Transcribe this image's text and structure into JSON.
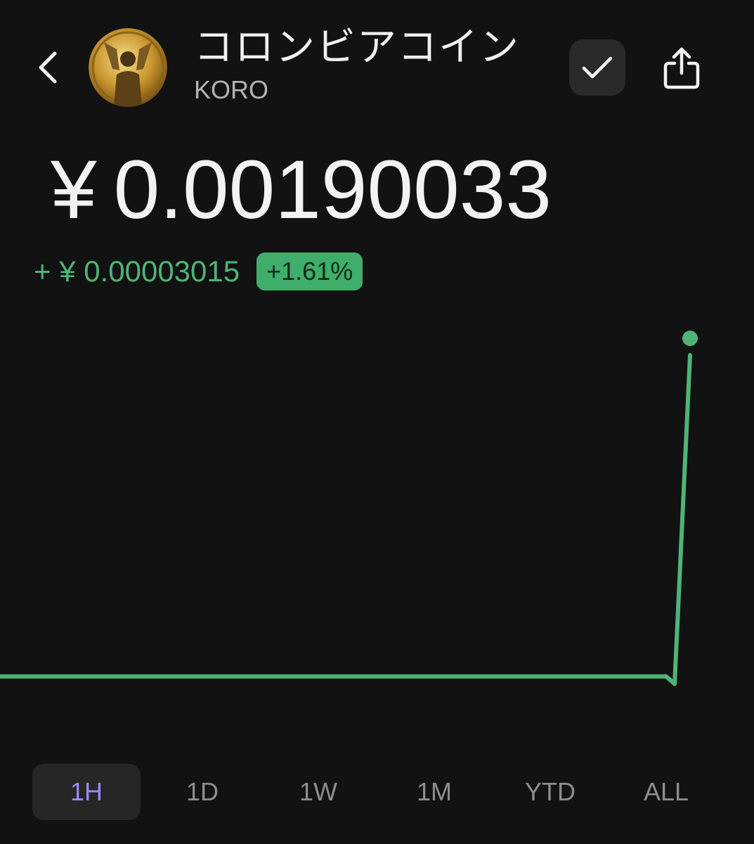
{
  "header": {
    "coin_name": "コロンビアコイン",
    "coin_symbol": "KORO"
  },
  "price": {
    "currency": "¥",
    "value": "0.00190033"
  },
  "change": {
    "absolute": "+ ¥ 0.00003015",
    "percent": "+1.61%",
    "color": "#4fb477"
  },
  "colors": {
    "background": "#121212",
    "accent_green": "#4fb477",
    "active_tab_text": "#9a8cff"
  },
  "icons": {
    "back": "chevron-left-icon",
    "watch": "checkmark-icon",
    "share": "share-icon"
  },
  "chart_data": {
    "type": "line",
    "series": [
      {
        "values": [
          0.0018702,
          0.0018702,
          0.0018702,
          0.0018702,
          0.0018702,
          0.0018702,
          0.0018702,
          0.0018702,
          0.0018702,
          0.0018702,
          0.0018695,
          0.0019003
        ]
      }
    ],
    "grid": false,
    "legend": "none"
  },
  "range_tabs": [
    {
      "label": "1H",
      "active": true
    },
    {
      "label": "1D",
      "active": false
    },
    {
      "label": "1W",
      "active": false
    },
    {
      "label": "1M",
      "active": false
    },
    {
      "label": "YTD",
      "active": false
    },
    {
      "label": "ALL",
      "active": false
    }
  ]
}
